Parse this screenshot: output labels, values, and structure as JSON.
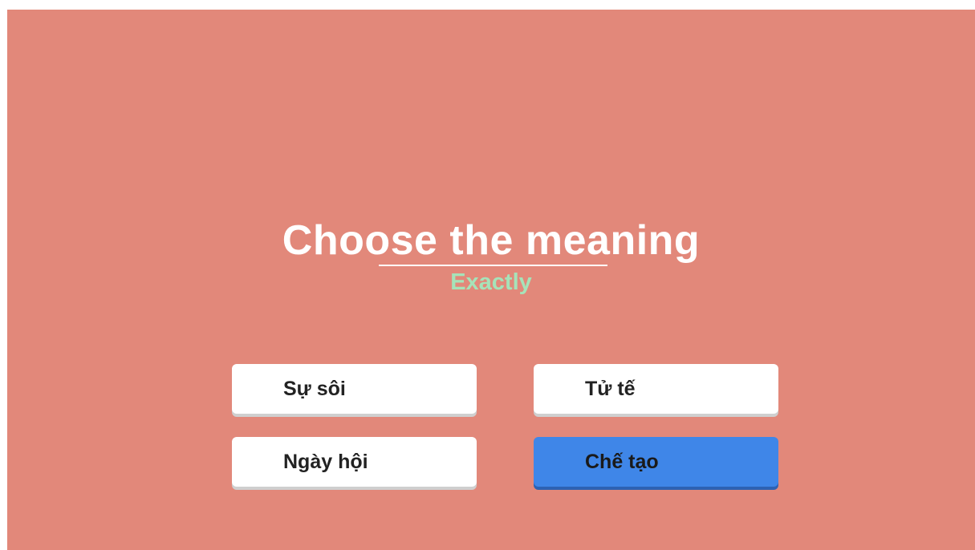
{
  "prompt": {
    "title": "Choose the meaning",
    "word": "Exactly"
  },
  "options": [
    {
      "label": "Sự sôi",
      "selected": false
    },
    {
      "label": "Tử tế",
      "selected": false
    },
    {
      "label": "Ngày hội",
      "selected": false
    },
    {
      "label": "Chế tạo",
      "selected": true
    }
  ],
  "colors": {
    "background": "#e2887a",
    "word": "#a6e3b9",
    "selected": "#3f86e8",
    "option": "#ffffff"
  }
}
